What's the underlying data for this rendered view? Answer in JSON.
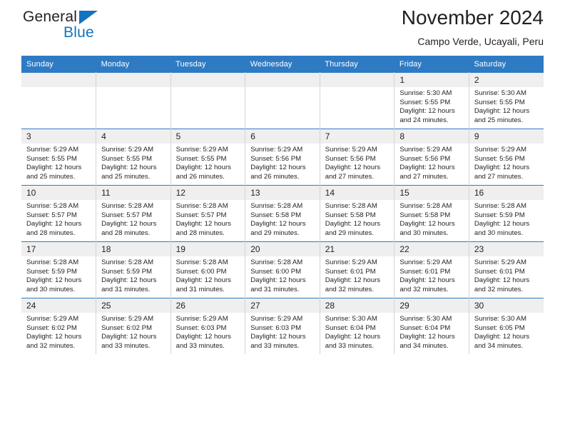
{
  "brand": {
    "name_top": "General",
    "name_bottom": "Blue",
    "triangle_color": "#1273bf"
  },
  "header": {
    "title": "November 2024",
    "subtitle": "Campo Verde, Ucayali, Peru"
  },
  "theme": {
    "header_blue": "#2e7bc4",
    "daynum_band": "#efefef",
    "grid_line": "#d4d4d4",
    "text": "#231f20"
  },
  "weekdays": [
    "Sunday",
    "Monday",
    "Tuesday",
    "Wednesday",
    "Thursday",
    "Friday",
    "Saturday"
  ],
  "weeks": [
    [
      {
        "day": ""
      },
      {
        "day": ""
      },
      {
        "day": ""
      },
      {
        "day": ""
      },
      {
        "day": ""
      },
      {
        "day": "1",
        "sunrise": "Sunrise: 5:30 AM",
        "sunset": "Sunset: 5:55 PM",
        "daylight": "Daylight: 12 hours and 24 minutes."
      },
      {
        "day": "2",
        "sunrise": "Sunrise: 5:30 AM",
        "sunset": "Sunset: 5:55 PM",
        "daylight": "Daylight: 12 hours and 25 minutes."
      }
    ],
    [
      {
        "day": "3",
        "sunrise": "Sunrise: 5:29 AM",
        "sunset": "Sunset: 5:55 PM",
        "daylight": "Daylight: 12 hours and 25 minutes."
      },
      {
        "day": "4",
        "sunrise": "Sunrise: 5:29 AM",
        "sunset": "Sunset: 5:55 PM",
        "daylight": "Daylight: 12 hours and 25 minutes."
      },
      {
        "day": "5",
        "sunrise": "Sunrise: 5:29 AM",
        "sunset": "Sunset: 5:55 PM",
        "daylight": "Daylight: 12 hours and 26 minutes."
      },
      {
        "day": "6",
        "sunrise": "Sunrise: 5:29 AM",
        "sunset": "Sunset: 5:56 PM",
        "daylight": "Daylight: 12 hours and 26 minutes."
      },
      {
        "day": "7",
        "sunrise": "Sunrise: 5:29 AM",
        "sunset": "Sunset: 5:56 PM",
        "daylight": "Daylight: 12 hours and 27 minutes."
      },
      {
        "day": "8",
        "sunrise": "Sunrise: 5:29 AM",
        "sunset": "Sunset: 5:56 PM",
        "daylight": "Daylight: 12 hours and 27 minutes."
      },
      {
        "day": "9",
        "sunrise": "Sunrise: 5:29 AM",
        "sunset": "Sunset: 5:56 PM",
        "daylight": "Daylight: 12 hours and 27 minutes."
      }
    ],
    [
      {
        "day": "10",
        "sunrise": "Sunrise: 5:28 AM",
        "sunset": "Sunset: 5:57 PM",
        "daylight": "Daylight: 12 hours and 28 minutes."
      },
      {
        "day": "11",
        "sunrise": "Sunrise: 5:28 AM",
        "sunset": "Sunset: 5:57 PM",
        "daylight": "Daylight: 12 hours and 28 minutes."
      },
      {
        "day": "12",
        "sunrise": "Sunrise: 5:28 AM",
        "sunset": "Sunset: 5:57 PM",
        "daylight": "Daylight: 12 hours and 28 minutes."
      },
      {
        "day": "13",
        "sunrise": "Sunrise: 5:28 AM",
        "sunset": "Sunset: 5:58 PM",
        "daylight": "Daylight: 12 hours and 29 minutes."
      },
      {
        "day": "14",
        "sunrise": "Sunrise: 5:28 AM",
        "sunset": "Sunset: 5:58 PM",
        "daylight": "Daylight: 12 hours and 29 minutes."
      },
      {
        "day": "15",
        "sunrise": "Sunrise: 5:28 AM",
        "sunset": "Sunset: 5:58 PM",
        "daylight": "Daylight: 12 hours and 30 minutes."
      },
      {
        "day": "16",
        "sunrise": "Sunrise: 5:28 AM",
        "sunset": "Sunset: 5:59 PM",
        "daylight": "Daylight: 12 hours and 30 minutes."
      }
    ],
    [
      {
        "day": "17",
        "sunrise": "Sunrise: 5:28 AM",
        "sunset": "Sunset: 5:59 PM",
        "daylight": "Daylight: 12 hours and 30 minutes."
      },
      {
        "day": "18",
        "sunrise": "Sunrise: 5:28 AM",
        "sunset": "Sunset: 5:59 PM",
        "daylight": "Daylight: 12 hours and 31 minutes."
      },
      {
        "day": "19",
        "sunrise": "Sunrise: 5:28 AM",
        "sunset": "Sunset: 6:00 PM",
        "daylight": "Daylight: 12 hours and 31 minutes."
      },
      {
        "day": "20",
        "sunrise": "Sunrise: 5:28 AM",
        "sunset": "Sunset: 6:00 PM",
        "daylight": "Daylight: 12 hours and 31 minutes."
      },
      {
        "day": "21",
        "sunrise": "Sunrise: 5:29 AM",
        "sunset": "Sunset: 6:01 PM",
        "daylight": "Daylight: 12 hours and 32 minutes."
      },
      {
        "day": "22",
        "sunrise": "Sunrise: 5:29 AM",
        "sunset": "Sunset: 6:01 PM",
        "daylight": "Daylight: 12 hours and 32 minutes."
      },
      {
        "day": "23",
        "sunrise": "Sunrise: 5:29 AM",
        "sunset": "Sunset: 6:01 PM",
        "daylight": "Daylight: 12 hours and 32 minutes."
      }
    ],
    [
      {
        "day": "24",
        "sunrise": "Sunrise: 5:29 AM",
        "sunset": "Sunset: 6:02 PM",
        "daylight": "Daylight: 12 hours and 32 minutes."
      },
      {
        "day": "25",
        "sunrise": "Sunrise: 5:29 AM",
        "sunset": "Sunset: 6:02 PM",
        "daylight": "Daylight: 12 hours and 33 minutes."
      },
      {
        "day": "26",
        "sunrise": "Sunrise: 5:29 AM",
        "sunset": "Sunset: 6:03 PM",
        "daylight": "Daylight: 12 hours and 33 minutes."
      },
      {
        "day": "27",
        "sunrise": "Sunrise: 5:29 AM",
        "sunset": "Sunset: 6:03 PM",
        "daylight": "Daylight: 12 hours and 33 minutes."
      },
      {
        "day": "28",
        "sunrise": "Sunrise: 5:30 AM",
        "sunset": "Sunset: 6:04 PM",
        "daylight": "Daylight: 12 hours and 33 minutes."
      },
      {
        "day": "29",
        "sunrise": "Sunrise: 5:30 AM",
        "sunset": "Sunset: 6:04 PM",
        "daylight": "Daylight: 12 hours and 34 minutes."
      },
      {
        "day": "30",
        "sunrise": "Sunrise: 5:30 AM",
        "sunset": "Sunset: 6:05 PM",
        "daylight": "Daylight: 12 hours and 34 minutes."
      }
    ]
  ]
}
